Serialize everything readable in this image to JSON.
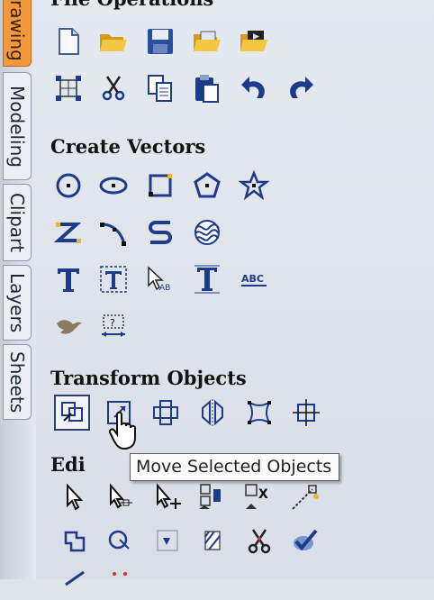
{
  "sidebar": {
    "tabs": [
      {
        "label": "rawing",
        "active": true
      },
      {
        "label": "Modeling",
        "active": false
      },
      {
        "label": "Clipart",
        "active": false
      },
      {
        "label": "Layers",
        "active": false
      },
      {
        "label": "Sheets",
        "active": false
      }
    ]
  },
  "sections": {
    "file_operations": {
      "title": "File Operations"
    },
    "create_vectors": {
      "title": "Create Vectors"
    },
    "transform_objects": {
      "title": "Transform Objects"
    },
    "edit": {
      "title": "Edi"
    }
  },
  "tooltip": {
    "text": "Move Selected Objects"
  },
  "colors": {
    "accent_tab": "#f29a3b",
    "icon_blue": "#1e3a8a",
    "folder_yellow": "#e8b730"
  },
  "icons": {
    "file_operations": [
      "new-file-icon",
      "open-folder-icon",
      "save-icon",
      "open-image-folder-icon",
      "open-video-folder-icon",
      "select-all-icon",
      "cut-icon",
      "copy-icon",
      "paste-icon",
      "undo-icon",
      "redo-icon"
    ],
    "create_vectors": [
      "circle-icon",
      "ellipse-icon",
      "rectangle-icon",
      "polygon-icon",
      "star-icon",
      "polyline-icon",
      "arc-icon",
      "s-curve-icon",
      "wave-fill-icon",
      "text-icon",
      "text-box-icon",
      "text-on-curve-icon",
      "text-stretch-icon",
      "text-on-line-icon",
      "bird-icon",
      "dimension-icon"
    ],
    "transform_objects": [
      "move-selected-objects-icon",
      "scale-icon",
      "position-align-icon",
      "mirror-icon",
      "distort-icon",
      "align-center-icon"
    ]
  }
}
